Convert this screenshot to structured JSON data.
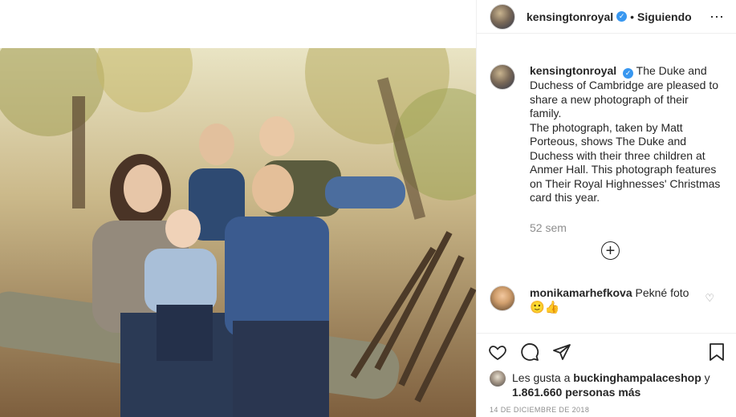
{
  "post": {
    "username": "kensingtonroyal",
    "verified": true,
    "separator": "•",
    "follow_status": "Siguiendo",
    "more_icon": "⋯"
  },
  "caption": {
    "username": "kensingtonroyal",
    "text_line1": "The Duke and Duchess of Cambridge are pleased to share a new photograph of their family.",
    "text_line2": "The photograph, taken by Matt Porteous, shows The Duke and Duchess with their three children at Anmer Hall. This photograph features on Their Royal Highnesses' Christmas card this year.",
    "time_ago": "52 sem"
  },
  "load_more_icon": "+",
  "comments": [
    {
      "username": "monikamarhefkova",
      "text": "Pekné foto",
      "emojis": "🙂👍"
    }
  ],
  "actions": {
    "like_icon": "heart-outline-icon",
    "comment_icon": "comment-icon",
    "share_icon": "share-icon",
    "save_icon": "bookmark-icon"
  },
  "likes": {
    "prefix": "Les gusta a",
    "user": "buckinghampalaceshop",
    "conj": "y",
    "count": "1.861.660",
    "suffix": "personas más"
  },
  "date": "14 DE DICIEMBRE DE 2018",
  "colors": {
    "link_blue": "#3897f0",
    "meta_gray": "#8e8e8e",
    "border": "#efefef"
  }
}
